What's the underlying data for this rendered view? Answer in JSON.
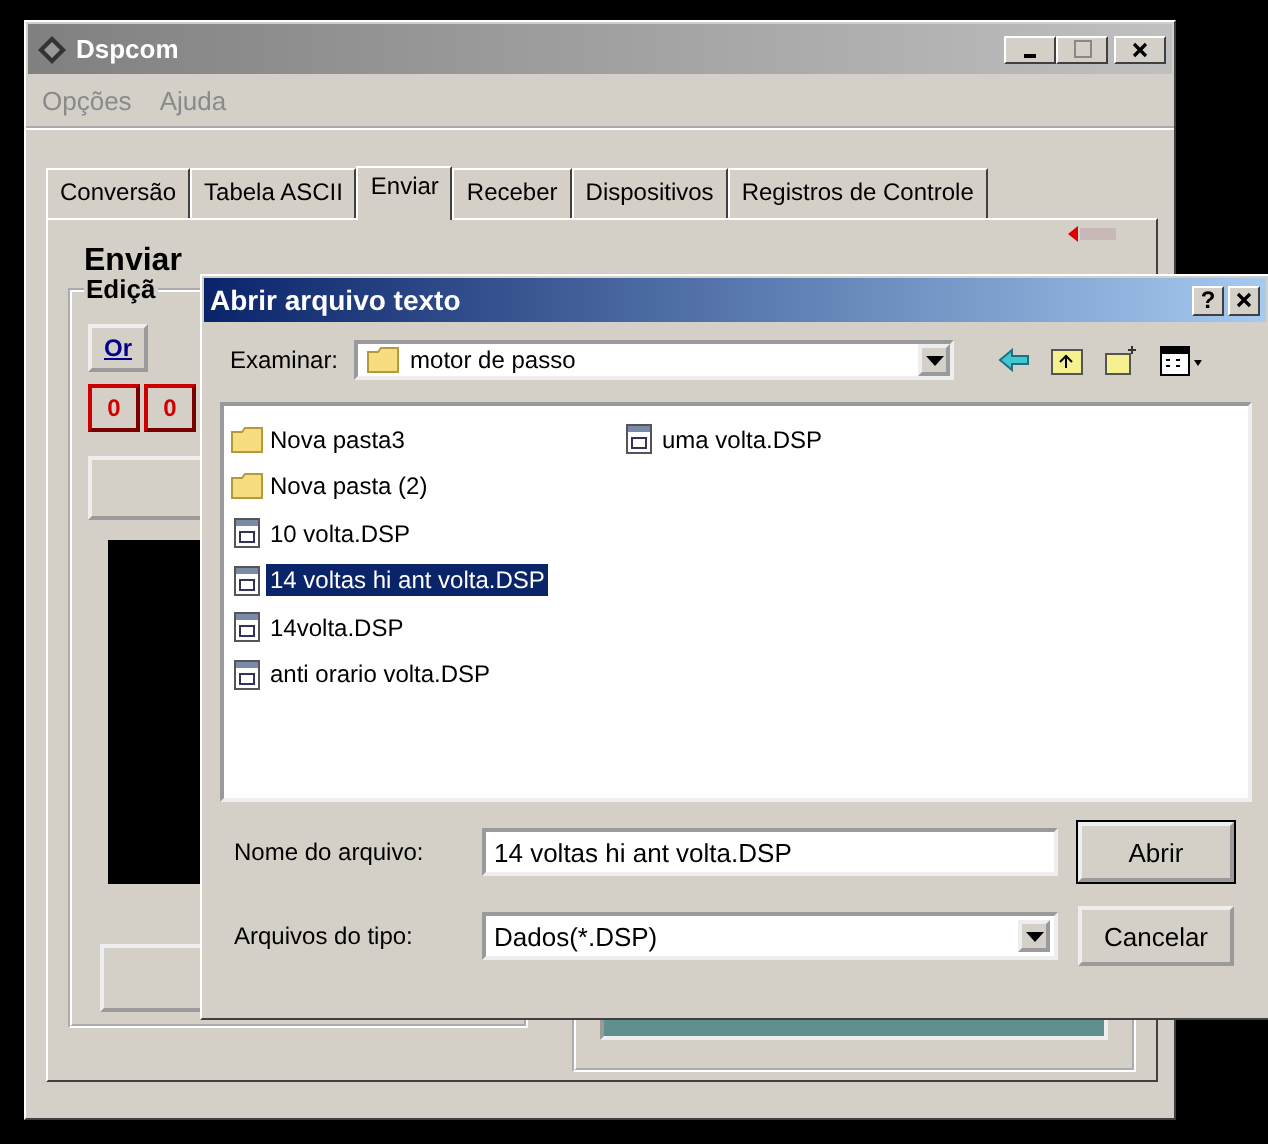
{
  "window": {
    "title": "Dspcom"
  },
  "menu": [
    "Opções",
    "Ajuda"
  ],
  "tabs": [
    {
      "label": "Conversão",
      "selected": false
    },
    {
      "label": "Tabela ASCII",
      "selected": false
    },
    {
      "label": "Enviar",
      "selected": true
    },
    {
      "label": "Receber",
      "selected": false
    },
    {
      "label": "Dispositivos",
      "selected": false
    },
    {
      "label": "Registros de Controle",
      "selected": false
    }
  ],
  "panel": {
    "heading": "Enviar",
    "group_label": "Ediçã",
    "format_button": "Or",
    "value_buttons": [
      "0",
      "0"
    ]
  },
  "dialog": {
    "title": "Abrir arquivo texto",
    "help": "?",
    "look_in_label": "Examinar:",
    "look_in_value": "motor de passo",
    "files": [
      {
        "name": "Nova pasta3",
        "kind": "folder",
        "selected": false
      },
      {
        "name": "Nova pasta (2)",
        "kind": "folder",
        "selected": false
      },
      {
        "name": "10 volta.DSP",
        "kind": "file",
        "selected": false
      },
      {
        "name": "14 voltas hi ant volta.DSP",
        "kind": "file",
        "selected": true
      },
      {
        "name": "14volta.DSP",
        "kind": "file",
        "selected": false
      },
      {
        "name": "anti orario volta.DSP",
        "kind": "file",
        "selected": false
      },
      {
        "name": "uma volta.DSP",
        "kind": "file",
        "selected": false
      }
    ],
    "filename_label": "Nome do arquivo:",
    "filename_value": "14 voltas hi ant volta.DSP",
    "filetype_label": "Arquivos do tipo:",
    "filetype_value": "Dados(*.DSP)",
    "buttons": [
      "Abrir",
      "Cancelar"
    ]
  }
}
